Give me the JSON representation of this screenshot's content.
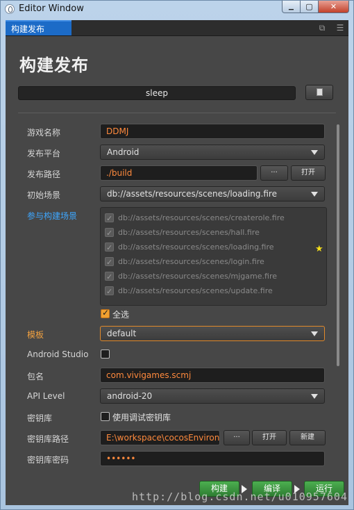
{
  "window": {
    "title": "Editor Window",
    "close_label": "✕",
    "min_label": "▁",
    "max_label": "▢"
  },
  "tabbar": {
    "tab_label": "构建发布"
  },
  "page": {
    "title": "构建发布",
    "profile_name": "sleep"
  },
  "form": {
    "game_name": {
      "label": "游戏名称",
      "value": "DDMJ"
    },
    "platform": {
      "label": "发布平台",
      "value": "Android"
    },
    "build_path": {
      "label": "发布路径",
      "value": "./build",
      "browse": "···",
      "open": "打开"
    },
    "start_scene": {
      "label": "初始场景",
      "value": "db://assets/resources/scenes/loading.fire"
    },
    "scenes": {
      "label": "参与构建场景",
      "items": [
        "db://assets/resources/scenes/createrole.fire",
        "db://assets/resources/scenes/hall.fire",
        "db://assets/resources/scenes/loading.fire",
        "db://assets/resources/scenes/login.fire",
        "db://assets/resources/scenes/mjgame.fire",
        "db://assets/resources/scenes/update.fire"
      ],
      "select_all": "全选"
    },
    "template": {
      "label": "模板",
      "value": "default"
    },
    "android_studio": {
      "label": "Android Studio",
      "checked": false
    },
    "package_name": {
      "label": "包名",
      "value": "com.vivigames.scmj"
    },
    "api_level": {
      "label": "API Level",
      "value": "android-20"
    },
    "keystore": {
      "label": "密钥库",
      "option": "使用调试密钥库",
      "checked": false
    },
    "keystore_path": {
      "label": "密钥库路径",
      "value": "E:\\workspace\\cocosEnvironme",
      "browse": "···",
      "open": "打开",
      "new": "新建"
    },
    "keystore_password": {
      "label": "密钥库密码",
      "value": "••••••"
    }
  },
  "actions": {
    "build": "构建",
    "compile": "编译",
    "run": "运行"
  },
  "watermark": "http://blog.csdn.net/u010957604",
  "colors": {
    "accent": "#1c6bc7",
    "input_text": "#ff8a3d",
    "green": "#2e7d32",
    "checkbox": "#f0a030"
  }
}
